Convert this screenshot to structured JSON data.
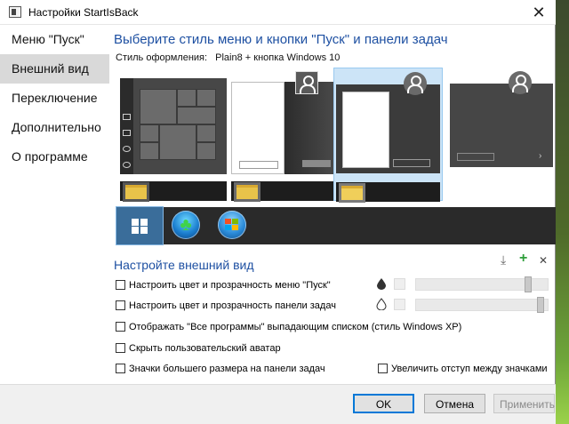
{
  "window": {
    "title": "Настройки StartIsBack",
    "close_glyph": "✕"
  },
  "nav": {
    "items": [
      {
        "label": "Меню \"Пуск\"",
        "active": false
      },
      {
        "label": "Внешний вид",
        "active": true
      },
      {
        "label": "Переключение",
        "active": false
      },
      {
        "label": "Дополнительно",
        "active": false
      },
      {
        "label": "О программе",
        "active": false
      }
    ]
  },
  "main": {
    "heading": "Выберите стиль меню и кнопки \"Пуск\" и панели задач",
    "style_label": "Стиль оформления:",
    "style_value": "Plain8 + кнопка Windows 10",
    "styles": [
      {
        "name": "tiles-dark",
        "selected": false
      },
      {
        "name": "classic-light",
        "selected": false
      },
      {
        "name": "plain8",
        "selected": true
      },
      {
        "name": "dark-square",
        "selected": false
      }
    ],
    "start_buttons": [
      {
        "name": "windows10-logo",
        "selected": true
      },
      {
        "name": "clover-orb",
        "selected": false
      },
      {
        "name": "windows7-orb",
        "selected": false
      }
    ],
    "customize_heading": "Настройте внешний вид",
    "tools": {
      "download_glyph": "⤓",
      "add_glyph": "+",
      "remove_glyph": "✕"
    },
    "options": {
      "menu_color": {
        "label": "Настроить цвет и прозрачность меню \"Пуск\"",
        "checked": false
      },
      "taskbar_color": {
        "label": "Настроить цвет и прозрачность панели задач",
        "checked": false
      },
      "all_programs_dropdown": {
        "label": "Отображать \"Все программы\" выпадающим списком (стиль Windows XP)",
        "checked": false
      },
      "hide_avatar": {
        "label": "Скрыть пользовательский аватар",
        "checked": false
      },
      "large_icons": {
        "label": "Значки большего размера на панели задач",
        "checked": false
      },
      "icon_spacing": {
        "label": "Увеличить отступ между значками",
        "checked": false
      }
    },
    "sliders": {
      "menu_transparency_fraction": 0.87,
      "taskbar_transparency_fraction": 0.97
    }
  },
  "footer": {
    "ok": "OK",
    "cancel": "Отмена",
    "apply": "Применить"
  },
  "colors": {
    "heading": "#1e50a2",
    "selection": "#cce4f7",
    "accent_button": "#0078d7"
  }
}
